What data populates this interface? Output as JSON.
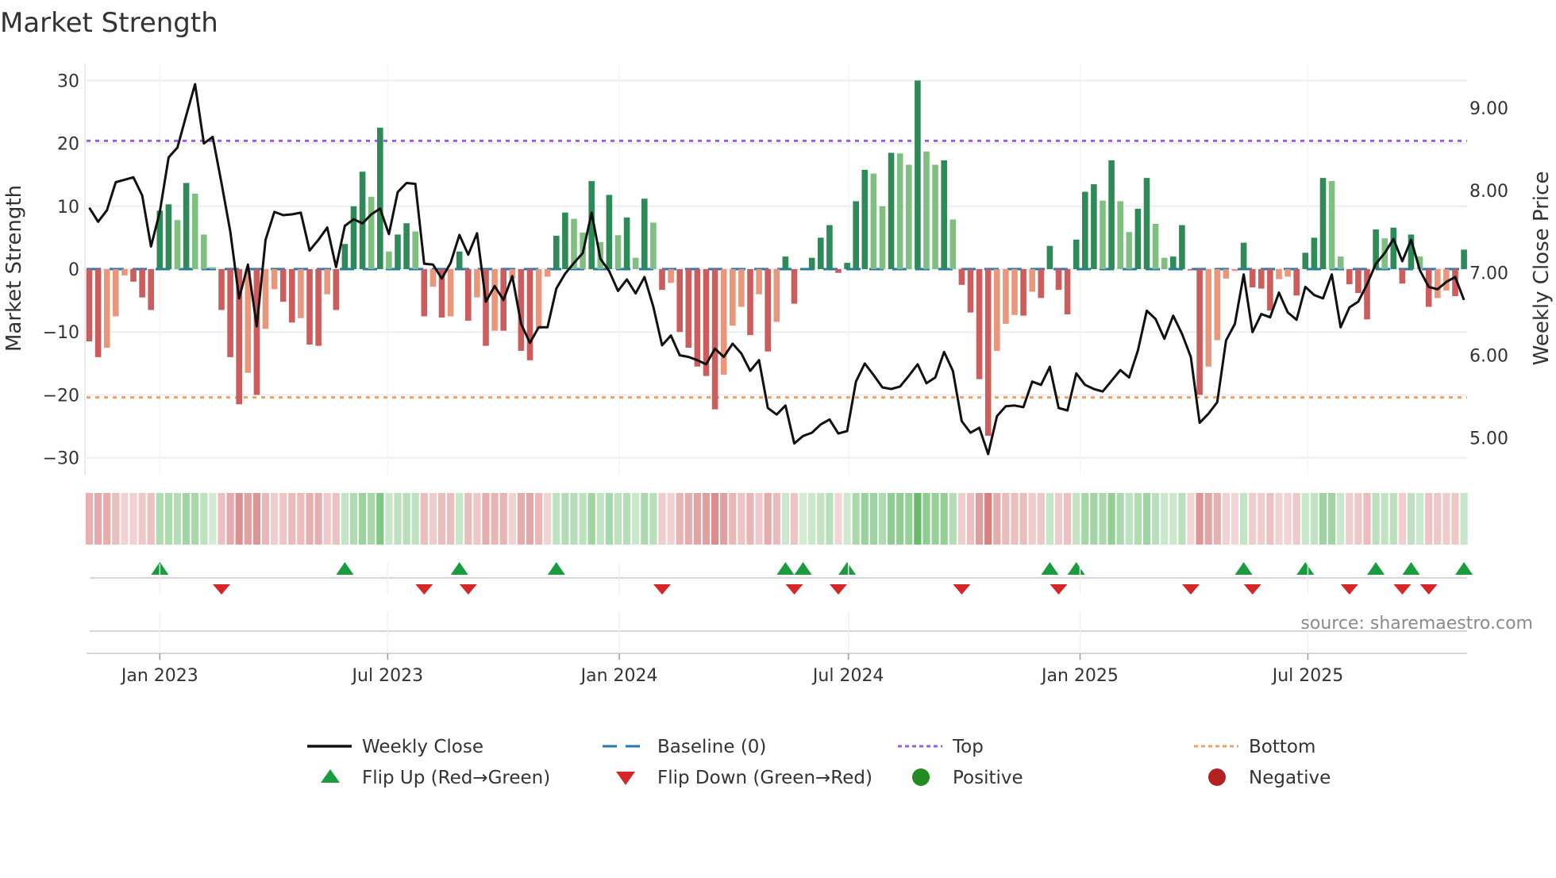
{
  "title": "Market Strength",
  "source_note": "source: sharemaestro.com",
  "chart_data": {
    "type": "bar+line",
    "title": "Market Strength",
    "ylabel_left": "Market Strength",
    "ylabel_right": "Weekly Close Price",
    "start_week": "2022-11-06",
    "interval_days": 7,
    "ylim_left": [
      -32.7,
      32.7
    ],
    "ylim_right": [
      4.55,
      9.54
    ],
    "left_ticks": [
      {
        "v": 30,
        "label": "30"
      },
      {
        "v": 20,
        "label": "20"
      },
      {
        "v": 10,
        "label": "10"
      },
      {
        "v": 0,
        "label": "0"
      },
      {
        "v": -10,
        "label": "−10"
      },
      {
        "v": -20,
        "label": "−20"
      },
      {
        "v": -30,
        "label": "−30"
      }
    ],
    "right_ticks": [
      {
        "v": 9,
        "label": "9.00"
      },
      {
        "v": 8,
        "label": "8.00"
      },
      {
        "v": 7,
        "label": "7.00"
      },
      {
        "v": 6,
        "label": "6.00"
      },
      {
        "v": 5,
        "label": "5.00"
      }
    ],
    "x_ticks": [
      {
        "date": "2023-01-01",
        "label": "Jan 2023"
      },
      {
        "date": "2023-07-01",
        "label": "Jul 2023"
      },
      {
        "date": "2024-01-01",
        "label": "Jan 2024"
      },
      {
        "date": "2024-07-01",
        "label": "Jul 2024"
      },
      {
        "date": "2025-01-01",
        "label": "Jan 2025"
      },
      {
        "date": "2025-07-01",
        "label": "Jul 2025"
      }
    ],
    "top_level": 20.4,
    "bottom_level": -20.4,
    "baseline": 0,
    "strength": [
      -11.5,
      -14,
      -12.5,
      -7.5,
      -1,
      -2,
      -4.5,
      -6.5,
      9.3,
      10.3,
      7.8,
      13.7,
      12,
      5.5,
      0.3,
      -6.5,
      -14,
      -21.5,
      -16.5,
      -20,
      -9.5,
      -3.2,
      -5.2,
      -8.5,
      -7.8,
      -12,
      -12.2,
      -4,
      -6.5,
      4,
      10,
      15.5,
      11.5,
      22.5,
      2.8,
      5.5,
      7.3,
      6,
      -7.5,
      -2.8,
      -7.7,
      -7.5,
      2.8,
      -8.2,
      -4.5,
      -12.2,
      -9.8,
      -9.8,
      -1.5,
      -13,
      -14.5,
      -9.5,
      -1.2,
      5.3,
      9,
      8,
      5.8,
      14,
      4.3,
      11.8,
      5.4,
      8.2,
      1.8,
      11.2,
      7.4,
      -3.3,
      -2.2,
      -10,
      -12.5,
      -15.5,
      -17,
      -22.3,
      -16.8,
      -9,
      -6,
      -10.5,
      -4,
      -13.1,
      -8.4,
      2,
      -5.5,
      0.1,
      1.8,
      5,
      7,
      -0.6,
      1,
      10.8,
      15.8,
      15.2,
      10,
      18.5,
      18.4,
      16.6,
      30,
      18.7,
      16.6,
      17.3,
      7.9,
      -2.5,
      -6.9,
      -17.5,
      -26.5,
      -13,
      -8.7,
      -7.3,
      -7.4,
      -3.6,
      -4.6,
      3.7,
      -3.3,
      -7.2,
      4.7,
      12.3,
      13.5,
      10.9,
      17.3,
      10.8,
      5.9,
      9.6,
      14.5,
      7.2,
      1.8,
      2,
      7,
      -0.2,
      -20,
      -15.5,
      -11.3,
      -1.5,
      -0.3,
      4.2,
      -2.9,
      -3.1,
      -6.6,
      -1.6,
      -1.2,
      -4.2,
      2.6,
      5,
      14.5,
      14,
      2,
      -2.4,
      -3.8,
      -8,
      6.3,
      4.9,
      6.6,
      -2.3,
      5.5,
      2,
      -6,
      -4.6,
      -3.4,
      -4.3,
      3.1
    ],
    "weekly_close": [
      7.79,
      7.62,
      7.76,
      8.1,
      8.13,
      8.16,
      7.94,
      7.32,
      7.74,
      8.4,
      8.52,
      8.91,
      9.29,
      8.57,
      8.65,
      8.09,
      7.5,
      6.69,
      7.1,
      6.35,
      7.4,
      7.74,
      7.7,
      7.71,
      7.73,
      7.27,
      7.4,
      7.55,
      7.07,
      7.57,
      7.65,
      7.6,
      7.71,
      7.78,
      7.47,
      7.98,
      8.09,
      8.08,
      7.11,
      7.1,
      6.93,
      7.12,
      7.46,
      7.22,
      7.48,
      6.65,
      6.84,
      6.67,
      6.96,
      6.38,
      6.15,
      6.34,
      6.34,
      6.81,
      6.99,
      7.12,
      7.24,
      7.73,
      7.17,
      7.02,
      6.78,
      6.92,
      6.75,
      6.95,
      6.59,
      6.12,
      6.24,
      6.0,
      5.98,
      5.94,
      5.89,
      6.08,
      5.98,
      6.14,
      6.02,
      5.81,
      5.94,
      5.36,
      5.28,
      5.39,
      4.93,
      5.02,
      5.06,
      5.16,
      5.22,
      5.05,
      5.08,
      5.68,
      5.9,
      5.76,
      5.61,
      5.59,
      5.62,
      5.75,
      5.89,
      5.66,
      5.73,
      6.04,
      5.81,
      5.2,
      5.06,
      5.12,
      4.8,
      5.26,
      5.38,
      5.39,
      5.37,
      5.68,
      5.64,
      5.86,
      5.36,
      5.33,
      5.78,
      5.64,
      5.59,
      5.56,
      5.69,
      5.82,
      5.73,
      6.06,
      6.54,
      6.44,
      6.2,
      6.48,
      6.26,
      5.98,
      5.18,
      5.29,
      5.43,
      6.18,
      6.38,
      6.98,
      6.28,
      6.5,
      6.46,
      6.76,
      6.52,
      6.43,
      6.83,
      6.73,
      6.69,
      6.98,
      6.34,
      6.58,
      6.65,
      6.86,
      7.11,
      7.24,
      7.41,
      7.14,
      7.4,
      7.03,
      6.83,
      6.8,
      6.89,
      6.95,
      6.67
    ],
    "legend": {
      "placement": "bottom",
      "items": [
        {
          "key": "weekly_close",
          "label": "Weekly Close"
        },
        {
          "key": "baseline",
          "label": "Baseline (0)"
        },
        {
          "key": "top",
          "label": "Top"
        },
        {
          "key": "bottom",
          "label": "Bottom"
        },
        {
          "key": "flip_up",
          "label": "Flip Up (Red→Green)"
        },
        {
          "key": "flip_down",
          "label": "Flip Down (Green→Red)"
        },
        {
          "key": "positive",
          "label": "Positive"
        },
        {
          "key": "negative",
          "label": "Negative"
        }
      ]
    },
    "colors": {
      "pos_strong": "#2e8b57",
      "pos_weak": "#7fc080",
      "neg_strong": "#cd5c5c",
      "neg_weak": "#e9967a",
      "close": "#111111",
      "baseline": "#1f77b4",
      "top": "#9a5fe0",
      "bottom": "#f0a060",
      "flip_up": "#1a9c3e",
      "flip_down": "#d62728",
      "positive": "#228b22",
      "negative": "#b22222",
      "heat_pos": "76,175,80",
      "heat_neg": "205,92,92",
      "grid": "#eceef3"
    }
  }
}
